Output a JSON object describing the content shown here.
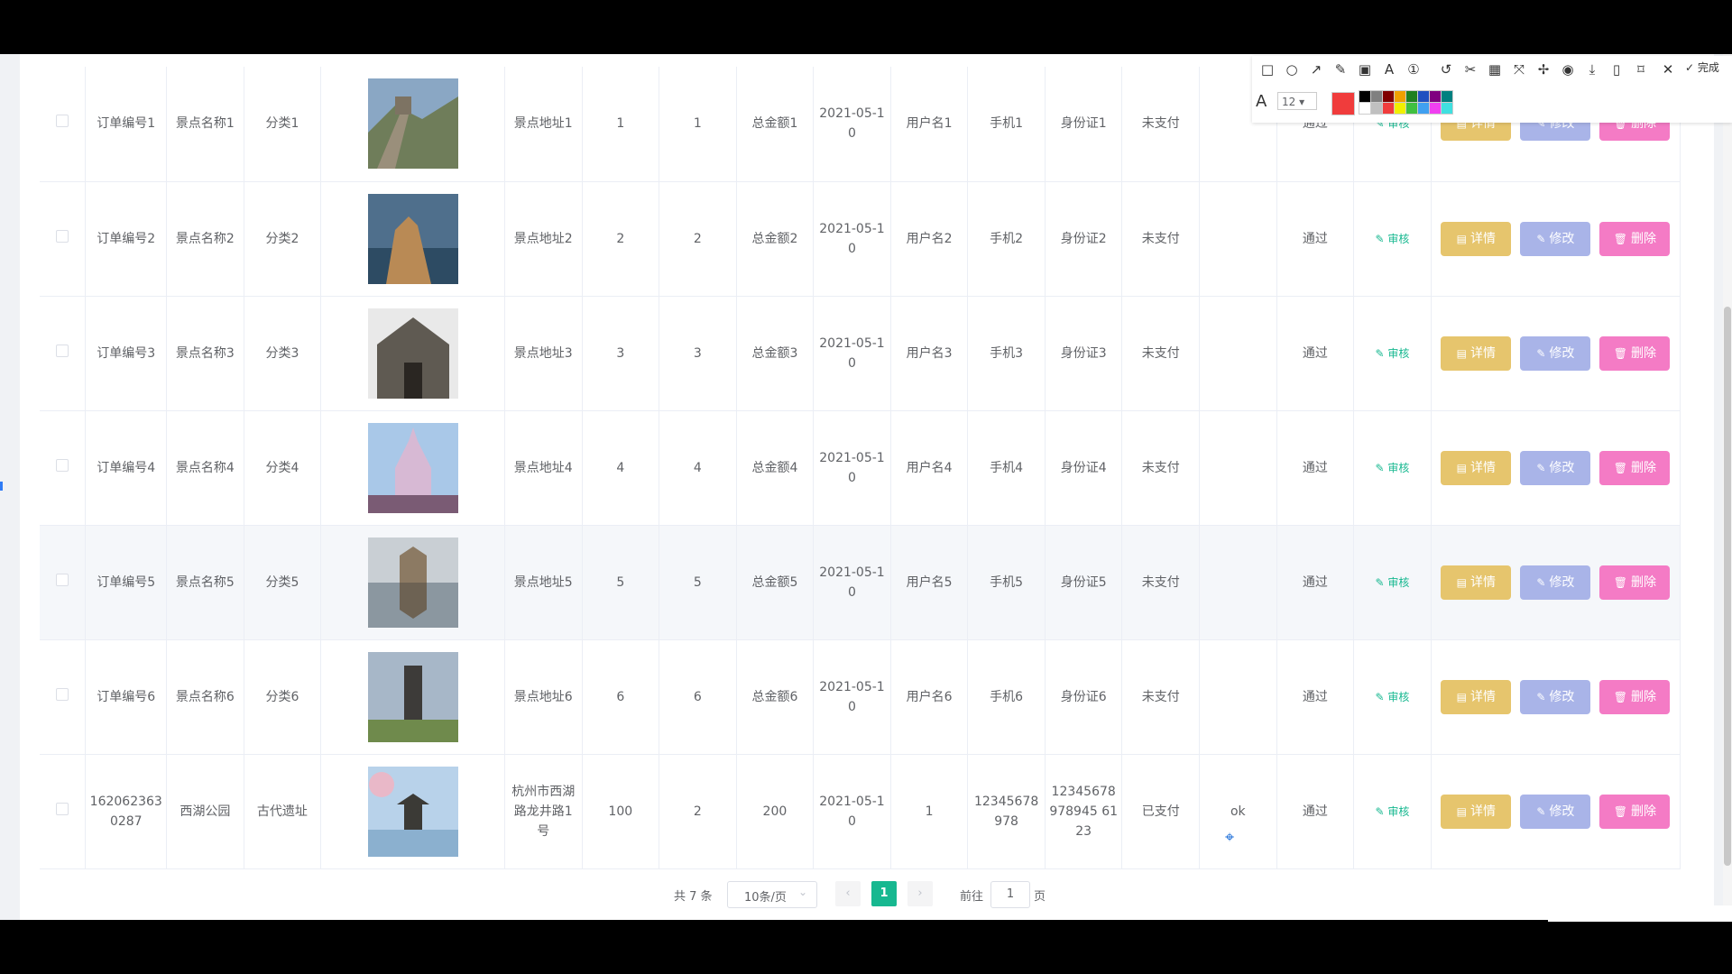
{
  "table": {
    "rows": [
      {
        "order": "订单编号1",
        "name": "景点名称1",
        "category": "分类1",
        "address": "景点地址1",
        "price": "1",
        "qty": "1",
        "total": "总金额1",
        "date": "2021-05-10",
        "user": "用户名1",
        "phone": "手机1",
        "idcard": "身份证1",
        "pay": "未支付",
        "remark": "",
        "audit_status": "通过",
        "audit": "审核",
        "thumb": "great-wall"
      },
      {
        "order": "订单编号2",
        "name": "景点名称2",
        "category": "分类2",
        "address": "景点地址2",
        "price": "2",
        "qty": "2",
        "total": "总金额2",
        "date": "2021-05-10",
        "user": "用户名2",
        "phone": "手机2",
        "idcard": "身份证2",
        "pay": "未支付",
        "remark": "",
        "audit_status": "通过",
        "audit": "审核",
        "thumb": "cliff"
      },
      {
        "order": "订单编号3",
        "name": "景点名称3",
        "category": "分类3",
        "address": "景点地址3",
        "price": "3",
        "qty": "3",
        "total": "总金额3",
        "date": "2021-05-10",
        "user": "用户名3",
        "phone": "手机3",
        "idcard": "身份证3",
        "pay": "未支付",
        "remark": "",
        "audit_status": "通过",
        "audit": "审核",
        "thumb": "ancient-gate"
      },
      {
        "order": "订单编号4",
        "name": "景点名称4",
        "category": "分类4",
        "address": "景点地址4",
        "price": "4",
        "qty": "4",
        "total": "总金额4",
        "date": "2021-05-10",
        "user": "用户名4",
        "phone": "手机4",
        "idcard": "身份证4",
        "pay": "未支付",
        "remark": "",
        "audit_status": "通过",
        "audit": "审核",
        "thumb": "castle"
      },
      {
        "order": "订单编号5",
        "name": "景点名称5",
        "category": "分类5",
        "address": "景点地址5",
        "price": "5",
        "qty": "5",
        "total": "总金额5",
        "date": "2021-05-10",
        "user": "用户名5",
        "phone": "手机5",
        "idcard": "身份证5",
        "pay": "未支付",
        "remark": "",
        "audit_status": "通过",
        "audit": "审核",
        "thumb": "arch-lake"
      },
      {
        "order": "订单编号6",
        "name": "景点名称6",
        "category": "分类6",
        "address": "景点地址6",
        "price": "6",
        "qty": "6",
        "total": "总金额6",
        "date": "2021-05-10",
        "user": "用户名6",
        "phone": "手机6",
        "idcard": "身份证6",
        "pay": "未支付",
        "remark": "",
        "audit_status": "通过",
        "audit": "审核",
        "thumb": "monument"
      },
      {
        "order": "1620623630287",
        "name": "西湖公园",
        "category": "古代遗址",
        "address": "杭州市西湖路龙井路1号",
        "price": "100",
        "qty": "2",
        "total": "200",
        "date": "2021-05-10",
        "user": "1",
        "phone": "12345678978",
        "idcard": "12345678978945 6123",
        "pay": "已支付",
        "remark": "ok",
        "audit_status": "通过",
        "audit": "审核",
        "thumb": "pagoda"
      }
    ],
    "actions": {
      "detail": "详情",
      "edit": "修改",
      "delete": "删除"
    }
  },
  "pagination": {
    "total": "共 7 条",
    "page_size": "10条/页",
    "current": "1",
    "goto": "前往",
    "goto_value": "1",
    "page_unit": "页"
  },
  "screenshot_toolbar": {
    "font_size": "12",
    "done": "完成",
    "current_color": "#f03c3c",
    "palette": [
      "#000000",
      "#808080",
      "#800000",
      "#f0a000",
      "#208020",
      "#2050c0",
      "#800080",
      "#008080",
      "#ffffff",
      "#c0c0c0",
      "#f03c3c",
      "#f0f000",
      "#40c040",
      "#40a0f0",
      "#f040f0",
      "#40e0e0"
    ]
  }
}
